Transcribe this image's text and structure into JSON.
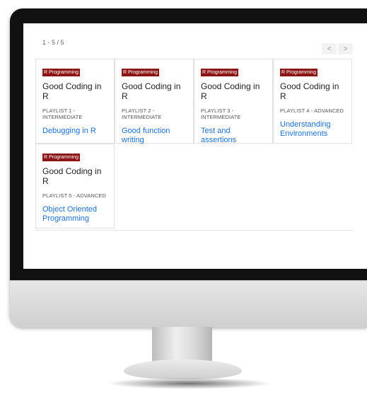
{
  "pagination": {
    "counter": "1 - 5 / 5",
    "prev": "<",
    "next": ">"
  },
  "cards": [
    {
      "tag": "R Programming",
      "title": "Good Coding in R",
      "playlist": "PLAYLIST 1 - INTERMEDIATE",
      "link": "Debugging in R"
    },
    {
      "tag": "R Programming",
      "title": "Good Coding in R",
      "playlist": "PLAYLIST 2 - INTERMEDIATE",
      "link": "Good function writing"
    },
    {
      "tag": "R Programming",
      "title": "Good Coding in R",
      "playlist": "PLAYLIST 3 - INTERMEDIATE",
      "link": "Test and assertions"
    },
    {
      "tag": "R Programming",
      "title": "Good Coding in R",
      "playlist": "PLAYLIST 4 - ADVANCED",
      "link": "Understanding Environments"
    },
    {
      "tag": "R Programming",
      "title": "Good Coding in R",
      "playlist": "PLAYLIST 5 - ADVANCED",
      "link": "Object Oriented Programming"
    }
  ],
  "colors": {
    "tag_bg": "#8b1414",
    "link": "#1f6fd0"
  }
}
